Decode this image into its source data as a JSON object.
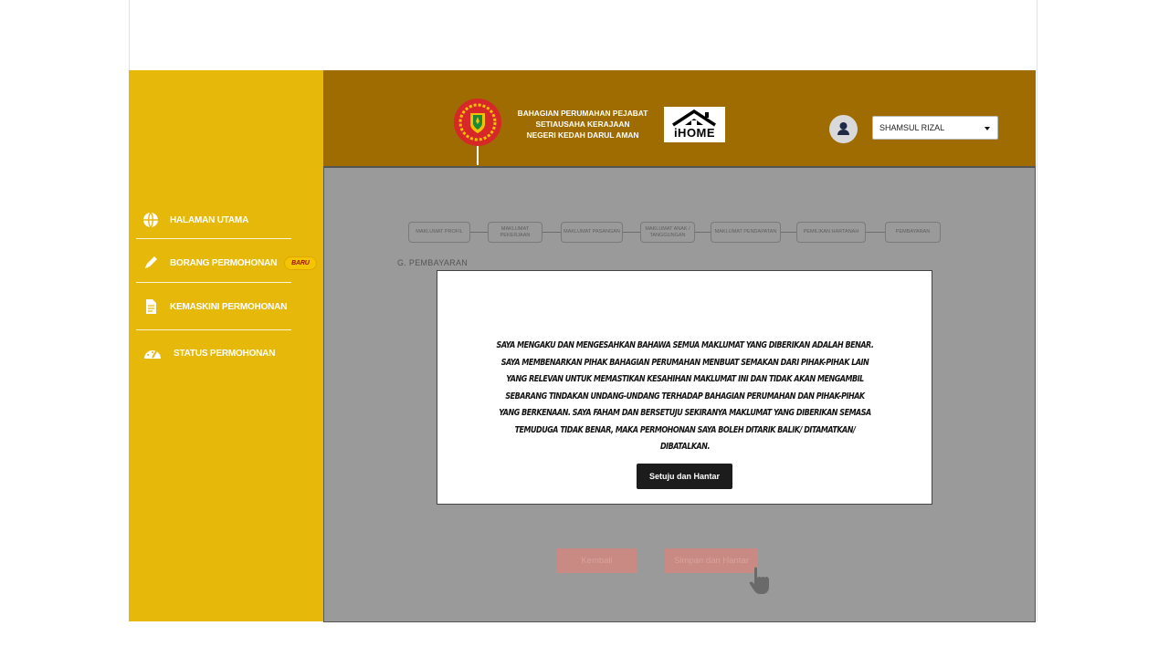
{
  "header": {
    "org_line1": "BAHAGIAN PERUMAHAN PEJABAT",
    "org_line2": "SETIAUSAHA KERAJAAN",
    "org_line3": "NEGERI KEDAH DARUL AMAN",
    "logo_label": "iHOME",
    "user_name": "SHAMSUL RIZAL"
  },
  "sidebar": {
    "items": [
      {
        "label": "HALAMAN UTAMA",
        "icon": "globe-icon"
      },
      {
        "label": "BORANG PERMOHONAN",
        "icon": "pen-icon",
        "badge": "BARU"
      },
      {
        "label": "KEMASKINI PERMOHONAN",
        "icon": "document-icon"
      },
      {
        "label": "STATUS PERMOHONAN",
        "icon": "gauge-icon"
      }
    ]
  },
  "steps": [
    {
      "label": "MAKLUMAT PROFIL"
    },
    {
      "label": "MAKLUMAT PEKERJAAN"
    },
    {
      "label": "MAKLUMAT PASANGAN"
    },
    {
      "label": "MAKLUMAT ANAK / TANGGUNGAN"
    },
    {
      "label": "MAKLUMAT PENDAPATAN"
    },
    {
      "label": "PEMILIKAN HARTANAH"
    },
    {
      "label": "PEMBAYARAN"
    }
  ],
  "section_label": "G. PEMBAYARAN",
  "modal": {
    "text": "Saya mengaku dan mengesahkan bahawa semua maklumat yang diberikan adalah benar. Saya membenarkan pihak Bahagian Perumahan menbuat semakan dari pihak-pihak lain yang relevan untuk memastikan kesahihan maklumat ini dan tidak akan mengambil sebarang tindakan undang-undang terhadap Bahagian Perumahan dan pihak-pihak yang berkenaan. Saya faham dan bersetuju sekiranya maklumat yang diberikan semasa temuduga tidak benar, maka permohonan saya boleh ditarik balik/ ditamatkan/ dibatalkan.",
    "confirm_label": "Setuju dan Hantar"
  },
  "buttons": {
    "back_label": "Kembali",
    "save_submit_label": "Simpan dan Hantar"
  },
  "colors": {
    "sidebar": "#e6b80a",
    "header": "#9e6c00",
    "overlay": "#9a9a9a",
    "modal_button": "#1c1c1c"
  }
}
